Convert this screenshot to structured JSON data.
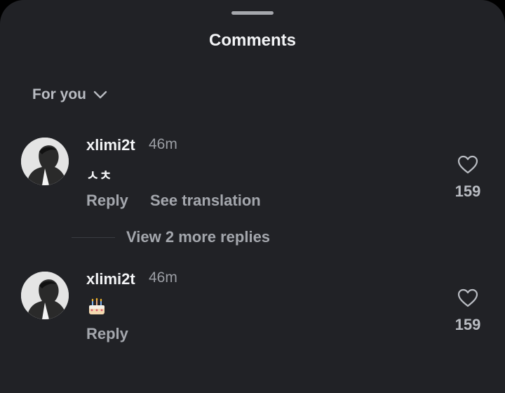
{
  "sheet": {
    "title": "Comments",
    "filter_label": "For you"
  },
  "comments": [
    {
      "username": "xlimi2t",
      "time": "46m",
      "text": "ㅅㅊ",
      "reply_label": "Reply",
      "translate_label": "See translation",
      "likes": "159"
    },
    {
      "username": "xlimi2t",
      "time": "46m",
      "emoji": "birthday-cake-emoji",
      "reply_label": "Reply",
      "likes": "159"
    }
  ],
  "thread": {
    "view_replies_label": "View 2 more replies"
  },
  "colors": {
    "sheet_bg": "#212226",
    "text_primary": "#f2f3f5",
    "text_secondary": "#a4a7ad"
  }
}
